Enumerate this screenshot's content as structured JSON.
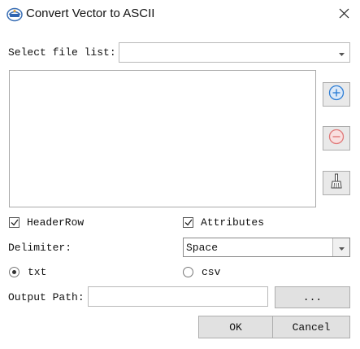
{
  "window": {
    "title": "Convert Vector to ASCII",
    "close_symbol": "✕"
  },
  "file_list": {
    "label": "Select file list:",
    "selected_value": "",
    "items": []
  },
  "side_buttons": {
    "add": "add-icon",
    "remove": "remove-icon",
    "clear": "broom-icon"
  },
  "options": {
    "header_row": {
      "label": "HeaderRow",
      "checked": true
    },
    "attributes": {
      "label": "Attributes",
      "checked": true
    }
  },
  "delimiter": {
    "label": "Delimiter:",
    "value": "Space"
  },
  "format": {
    "txt": {
      "label": "txt",
      "selected": true
    },
    "csv": {
      "label": "csv",
      "selected": false
    }
  },
  "output": {
    "label": "Output Path:",
    "value": "",
    "browse_label": "..."
  },
  "actions": {
    "ok_label": "OK",
    "cancel_label": "Cancel"
  },
  "colors": {
    "add_accent": "#2f7fd6",
    "remove_accent": "#e07a7a"
  }
}
